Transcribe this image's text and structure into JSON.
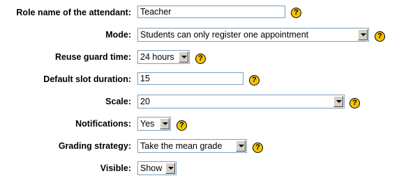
{
  "form": {
    "role_name": {
      "label": "Role name of the attendant:",
      "value": "Teacher"
    },
    "mode": {
      "label": "Mode:",
      "value": "Students can only register one appointment"
    },
    "reuse_guard": {
      "label": "Reuse guard time:",
      "value": "24 hours"
    },
    "slot_duration": {
      "label": "Default slot duration:",
      "value": "15"
    },
    "scale": {
      "label": "Scale:",
      "value": "20"
    },
    "notifications": {
      "label": "Notifications:",
      "value": "Yes"
    },
    "grading": {
      "label": "Grading strategy:",
      "value": "Take the mean grade"
    },
    "visible": {
      "label": "Visible:",
      "value": "Show"
    }
  },
  "help_icon_glyph": "?",
  "icons": {
    "help": "help-icon",
    "dropdown": "chevron-down-icon"
  },
  "colors": {
    "help_icon": "#f5c400",
    "input_border": "#7f9db9"
  }
}
